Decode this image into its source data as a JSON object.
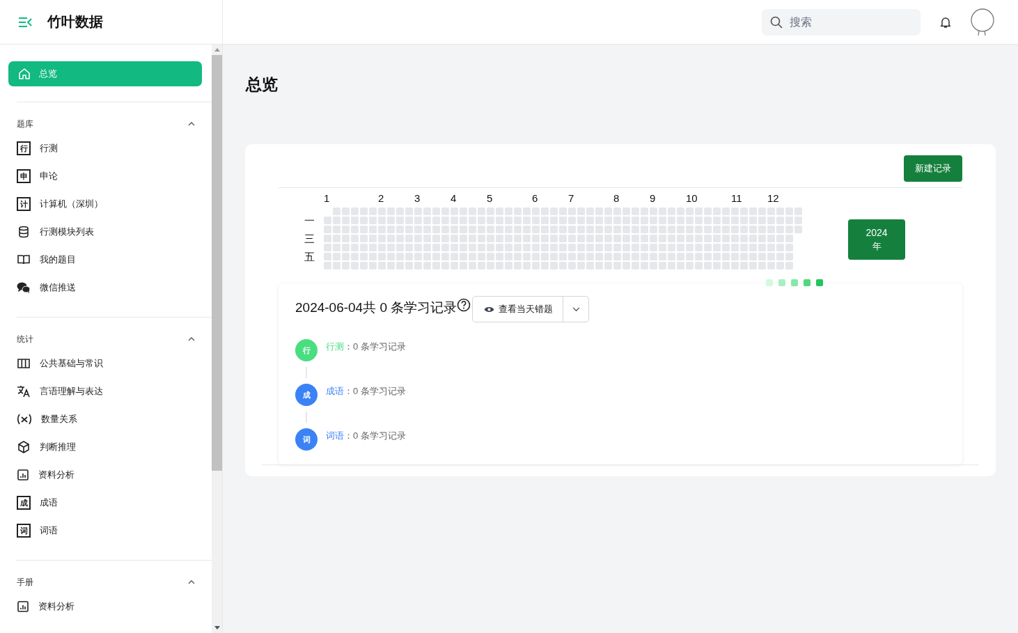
{
  "brand": {
    "name": "竹叶数据"
  },
  "search": {
    "placeholder": "搜索"
  },
  "nav_home": {
    "label": "总览",
    "selected": true
  },
  "sidebar": {
    "sections": [
      {
        "title": "题库",
        "expanded": true,
        "items": [
          {
            "label": "行测",
            "kind": "glyph",
            "glyph": "行"
          },
          {
            "label": "申论",
            "kind": "glyph",
            "glyph": "申"
          },
          {
            "label": "计算机（深圳）",
            "kind": "glyph",
            "glyph": "计"
          },
          {
            "label": "行测模块列表",
            "kind": "database"
          },
          {
            "label": "我的题目",
            "kind": "book"
          },
          {
            "label": "微信推送",
            "kind": "chat"
          }
        ]
      },
      {
        "title": "统计",
        "expanded": true,
        "items": [
          {
            "label": "公共基础与常识",
            "kind": "columns"
          },
          {
            "label": "言语理解与表达",
            "kind": "translate"
          },
          {
            "label": "数量关系",
            "kind": "variable"
          },
          {
            "label": "判断推理",
            "kind": "cube"
          },
          {
            "label": "资料分析",
            "kind": "chart"
          },
          {
            "label": "成语",
            "kind": "glyph",
            "glyph": "成"
          },
          {
            "label": "词语",
            "kind": "glyph",
            "glyph": "词"
          }
        ]
      },
      {
        "title": "手册",
        "expanded": true,
        "items": [
          {
            "label": "资料分析",
            "kind": "chart"
          }
        ]
      }
    ]
  },
  "page": {
    "title": "总览"
  },
  "new_button": "新建记录",
  "heatmap": {
    "months": [
      "1",
      "2",
      "3",
      "4",
      "5",
      "6",
      "7",
      "8",
      "9",
      "10",
      "11",
      "12"
    ],
    "weekday_labels": [
      "一",
      "三",
      "五"
    ],
    "legend": [
      {
        "color": "#d1fadf"
      },
      {
        "color": "#a7f0c4"
      },
      {
        "color": "#86e8a8"
      },
      {
        "color": "#4fd87e"
      },
      {
        "color": "#22c55e"
      }
    ]
  },
  "year_button": {
    "year": "2024",
    "unit": "年"
  },
  "day_summary": {
    "title": "2024-06-04共 0 条学习记录",
    "button": "查看当天错题"
  },
  "timeline": [
    {
      "badge": "行",
      "name": "行测",
      "text": "：0 条学习记录",
      "color": "#4ade80"
    },
    {
      "badge": "成",
      "name": "成语",
      "text": "：0 条学习记录",
      "color": "#3b82f6"
    },
    {
      "badge": "词",
      "name": "词语",
      "text": "：0 条学习记录",
      "color": "#3b82f6"
    }
  ]
}
